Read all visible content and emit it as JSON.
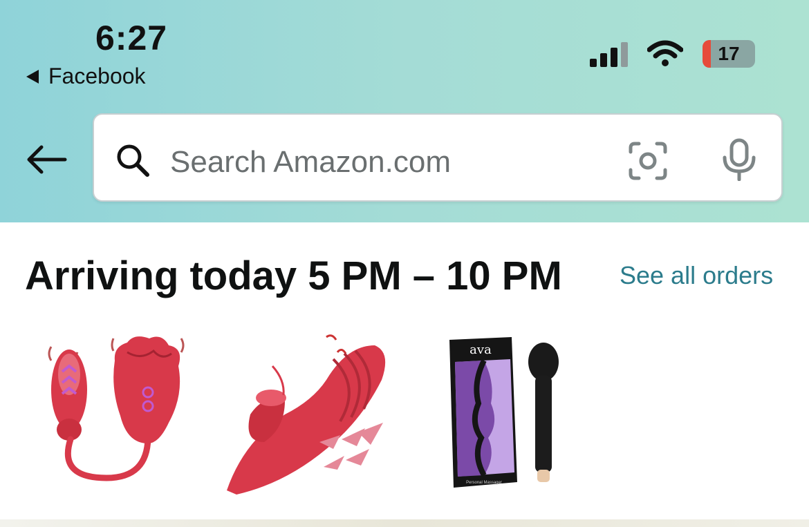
{
  "status_bar": {
    "time": "6:27",
    "back_app": "Facebook",
    "battery_level": "17",
    "signal_bars": 3,
    "signal_bars_total": 4
  },
  "search": {
    "placeholder": "Search Amazon.com",
    "back_icon": "back-arrow-icon",
    "search_icon": "search-icon",
    "camera_icon": "camera-lens-icon",
    "mic_icon": "microphone-icon"
  },
  "orders": {
    "title": "Arriving today 5 PM – 10 PM",
    "see_all_label": "See all orders",
    "items": [
      {
        "icon": "product-image"
      },
      {
        "icon": "product-image"
      },
      {
        "icon": "product-image",
        "box_brand": "ava",
        "box_caption": "Personal Massager"
      }
    ]
  },
  "colors": {
    "header_gradient_start": "#8fd3d9",
    "header_gradient_end": "#ace2d2",
    "link": "#2c7c8c",
    "battery_low": "#e64b3a",
    "product_red": "#d83a4a"
  }
}
